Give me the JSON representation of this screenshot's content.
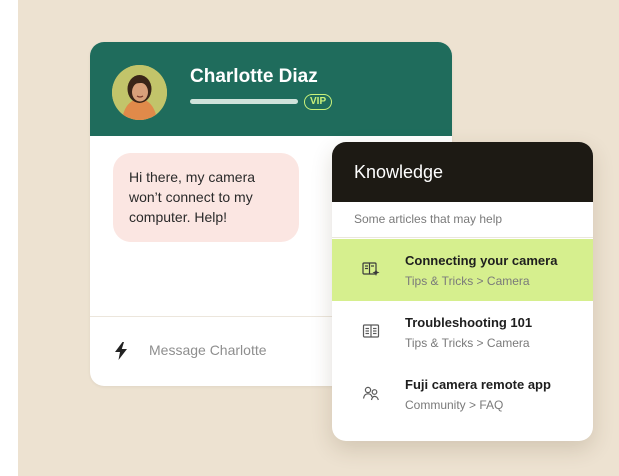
{
  "chat": {
    "contact_name": "Charlotte Diaz",
    "badge": "VIP",
    "message": "Hi there, my camera won’t connect to my computer. Help!",
    "input_placeholder": "Message Charlotte"
  },
  "knowledge": {
    "title": "Knowledge",
    "subtitle": "Some articles that may help",
    "articles": [
      {
        "title": "Connecting your camera",
        "path": "Tips & Tricks > Camera",
        "icon": "article-sparkle-icon",
        "highlighted": true
      },
      {
        "title": "Troubleshooting 101",
        "path": "Tips & Tricks > Camera",
        "icon": "book-icon",
        "highlighted": false
      },
      {
        "title": "Fuji camera remote app",
        "path": "Community > FAQ",
        "icon": "community-icon",
        "highlighted": false
      }
    ]
  },
  "colors": {
    "background": "#ede2d1",
    "chat_header": "#1f6c5c",
    "knowledge_header": "#1d1a14",
    "highlight": "#d6ef8e",
    "vip_accent": "#c9f27a",
    "bubble": "#fbe6e2"
  }
}
